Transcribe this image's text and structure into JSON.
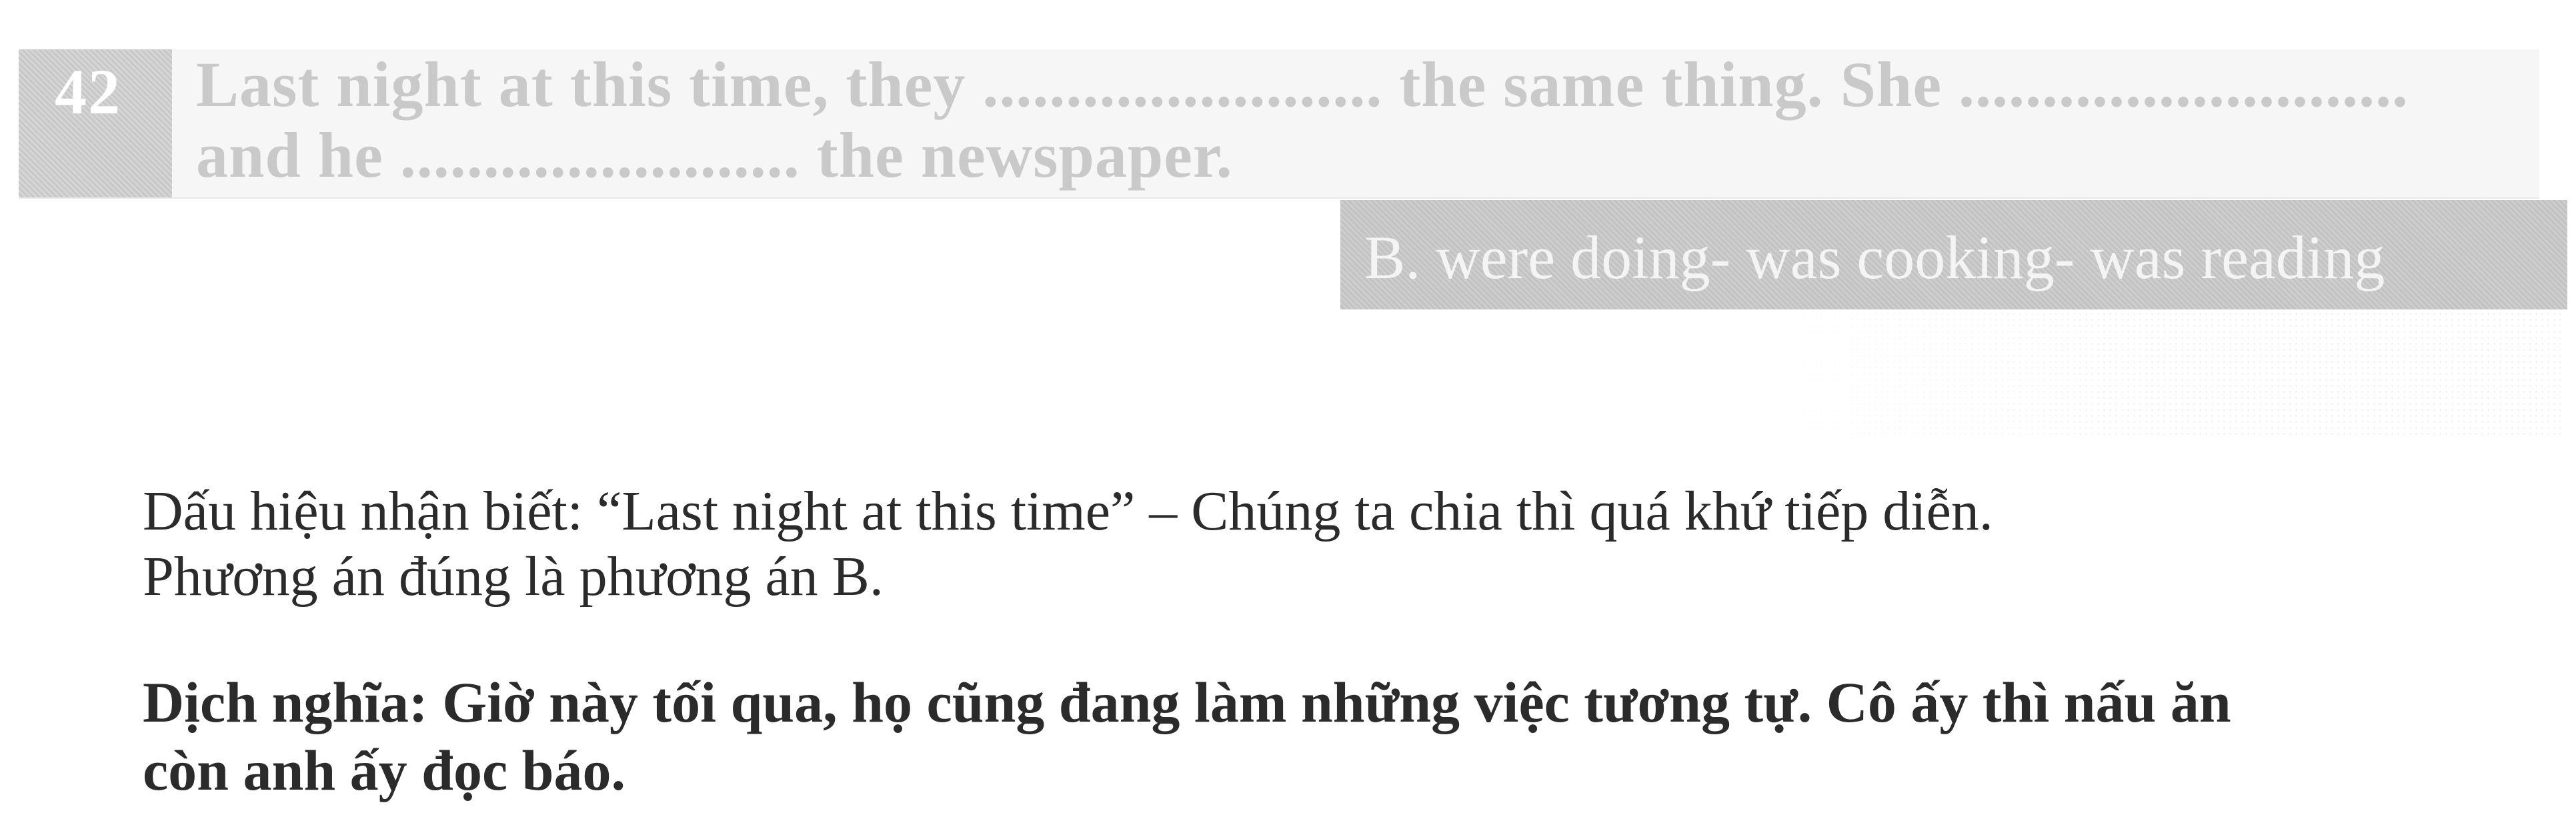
{
  "question": {
    "number": "42",
    "line1": "Last night at this time, they ........................ the same thing. She ...........................",
    "line2": "and he ........................ the newspaper."
  },
  "answer": {
    "text": "B. were doing- was cooking- was reading"
  },
  "explanation": {
    "line1": "Dấu hiệu nhận biết: “Last night at this time” – Chúng ta chia thì quá khứ tiếp diễn.",
    "line2": "Phương án đúng là phương án B."
  },
  "translation": {
    "line1": "Dịch nghĩa: Giờ này tối qua, họ cũng đang làm những việc tương tự. Cô ấy thì nấu ăn",
    "line2": "còn anh ấy đọc báo."
  }
}
